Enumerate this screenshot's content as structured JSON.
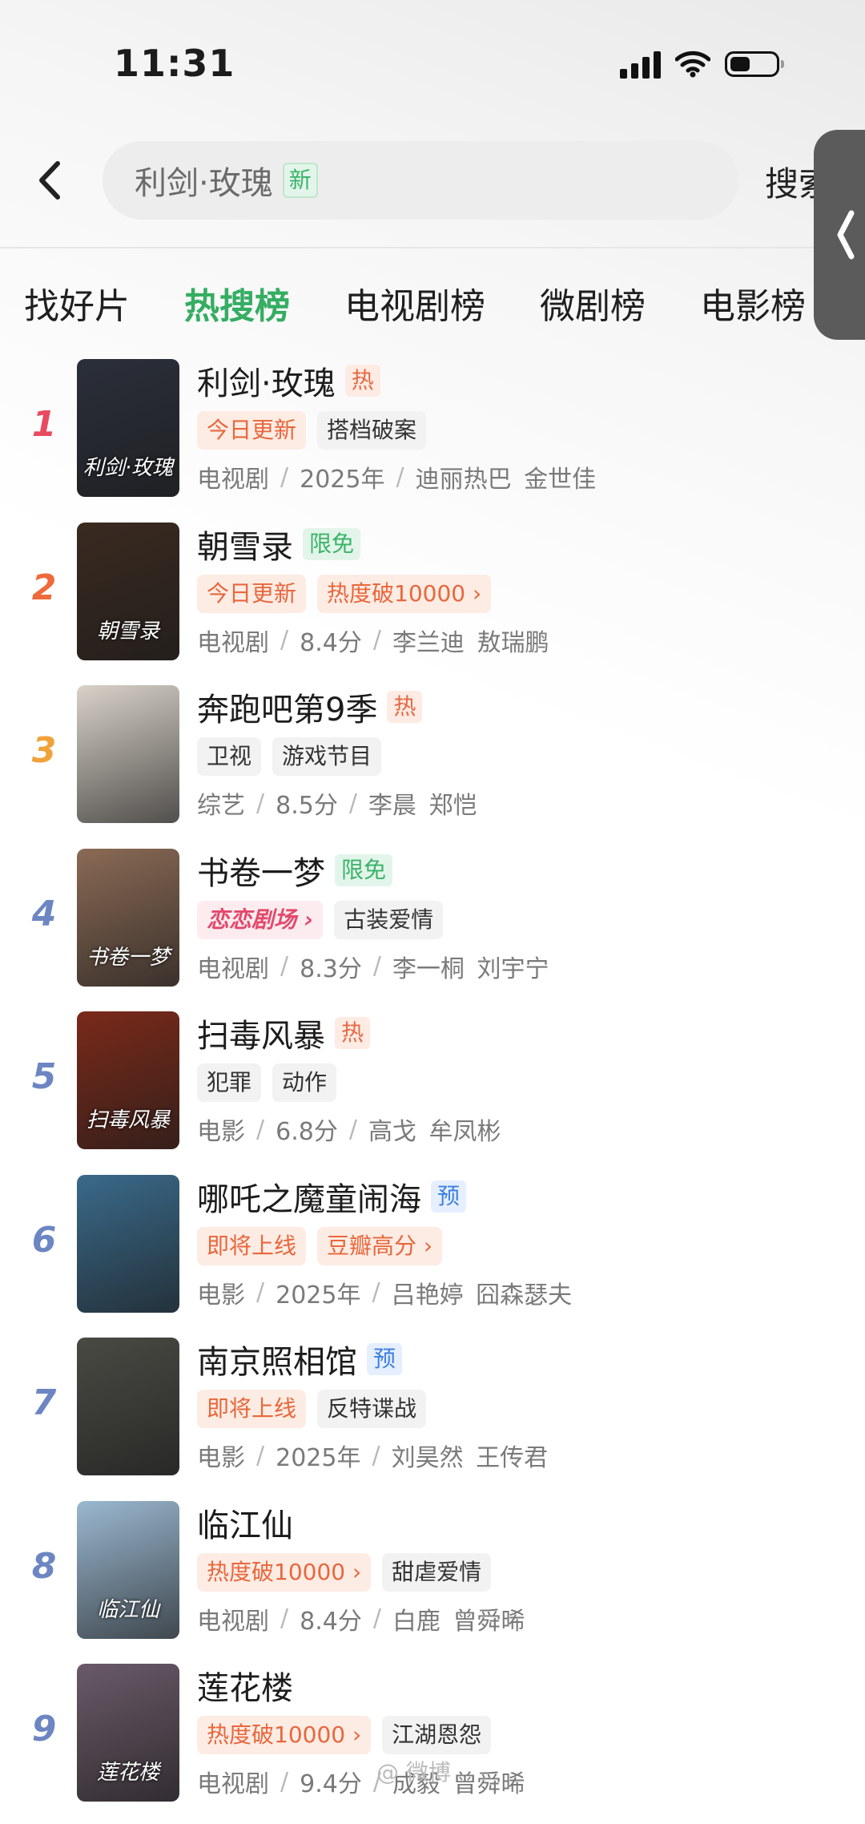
{
  "status_bar": {
    "time": "11:31"
  },
  "search": {
    "query": "利剑·玫瑰",
    "query_badge": "新",
    "button_label": "搜索"
  },
  "tabs": [
    {
      "label": "找好片",
      "active": false
    },
    {
      "label": "热搜榜",
      "active": true
    },
    {
      "label": "电视剧榜",
      "active": false
    },
    {
      "label": "微剧榜",
      "active": false
    },
    {
      "label": "电影榜",
      "active": false
    }
  ],
  "items": [
    {
      "rank": "1",
      "title": "利剑·玫瑰",
      "badge": "热",
      "badge_type": "hot",
      "poster_text": "利剑·玫瑰",
      "tags": [
        {
          "label": "今日更新",
          "style": "orange"
        },
        {
          "label": "搭档破案",
          "style": "gray"
        }
      ],
      "meta": {
        "category": "电视剧",
        "info": "2025年",
        "cast": "迪丽热巴 金世佳"
      }
    },
    {
      "rank": "2",
      "title": "朝雪录",
      "badge": "限免",
      "badge_type": "free",
      "poster_text": "朝雪录",
      "tags": [
        {
          "label": "今日更新",
          "style": "orange"
        },
        {
          "label": "热度破10000 ›",
          "style": "orange"
        }
      ],
      "meta": {
        "category": "电视剧",
        "info": "8.4分",
        "cast": "李兰迪 敖瑞鹏"
      }
    },
    {
      "rank": "3",
      "title": "奔跑吧第9季",
      "badge": "热",
      "badge_type": "hot",
      "poster_text": "",
      "tags": [
        {
          "label": "卫视",
          "style": "gray"
        },
        {
          "label": "游戏节目",
          "style": "gray"
        }
      ],
      "meta": {
        "category": "综艺",
        "info": "8.5分",
        "cast": "李晨 郑恺"
      }
    },
    {
      "rank": "4",
      "title": "书卷一梦",
      "badge": "限免",
      "badge_type": "free",
      "poster_text": "书卷一梦",
      "tags": [
        {
          "label": "恋恋剧场 ›",
          "style": "brand"
        },
        {
          "label": "古装爱情",
          "style": "gray"
        }
      ],
      "meta": {
        "category": "电视剧",
        "info": "8.3分",
        "cast": "李一桐 刘宇宁"
      }
    },
    {
      "rank": "5",
      "title": "扫毒风暴",
      "badge": "热",
      "badge_type": "hot",
      "poster_text": "扫毒风暴",
      "tags": [
        {
          "label": "犯罪",
          "style": "gray"
        },
        {
          "label": "动作",
          "style": "gray"
        }
      ],
      "meta": {
        "category": "电影",
        "info": "6.8分",
        "cast": "高戈 牟凤彬"
      }
    },
    {
      "rank": "6",
      "title": "哪吒之魔童闹海",
      "badge": "预",
      "badge_type": "pre",
      "poster_text": "",
      "tags": [
        {
          "label": "即将上线",
          "style": "orange"
        },
        {
          "label": "豆瓣高分 ›",
          "style": "orange"
        }
      ],
      "meta": {
        "category": "电影",
        "info": "2025年",
        "cast": "吕艳婷 囧森瑟夫"
      }
    },
    {
      "rank": "7",
      "title": "南京照相馆",
      "badge": "预",
      "badge_type": "pre",
      "poster_text": "",
      "tags": [
        {
          "label": "即将上线",
          "style": "orange"
        },
        {
          "label": "反特谍战",
          "style": "gray"
        }
      ],
      "meta": {
        "category": "电影",
        "info": "2025年",
        "cast": "刘昊然 王传君"
      }
    },
    {
      "rank": "8",
      "title": "临江仙",
      "badge": "",
      "badge_type": "",
      "poster_text": "临江仙",
      "tags": [
        {
          "label": "热度破10000 ›",
          "style": "orange"
        },
        {
          "label": "甜虐爱情",
          "style": "gray"
        }
      ],
      "meta": {
        "category": "电视剧",
        "info": "8.4分",
        "cast": "白鹿 曾舜晞"
      }
    },
    {
      "rank": "9",
      "title": "莲花楼",
      "badge": "",
      "badge_type": "",
      "poster_text": "莲花楼",
      "tags": [
        {
          "label": "热度破10000 ›",
          "style": "orange"
        },
        {
          "label": "江湖恩怨",
          "style": "gray"
        }
      ],
      "meta": {
        "category": "电视剧",
        "info": "9.4分",
        "cast": "成毅 曾舜晞"
      }
    }
  ],
  "colors": {
    "accent_green": "#35ad62",
    "rank_1": "#e84a5f",
    "rank_2": "#ee6a3a",
    "rank_3": "#f0a23a",
    "rank_other": "#6d86c3",
    "posters": [
      "#2b2f3a",
      "#3a2a20",
      "#d8d2c8",
      "#8a6a55",
      "#7a2a1a",
      "#3a6a8a",
      "#4a4a44",
      "#9ab8d0",
      "#6a5a68"
    ]
  },
  "icons": [
    "chevron-left-icon",
    "signal-icon",
    "wifi-icon",
    "battery-icon",
    "chevron-left-icon"
  ],
  "watermark": "@ 微博"
}
